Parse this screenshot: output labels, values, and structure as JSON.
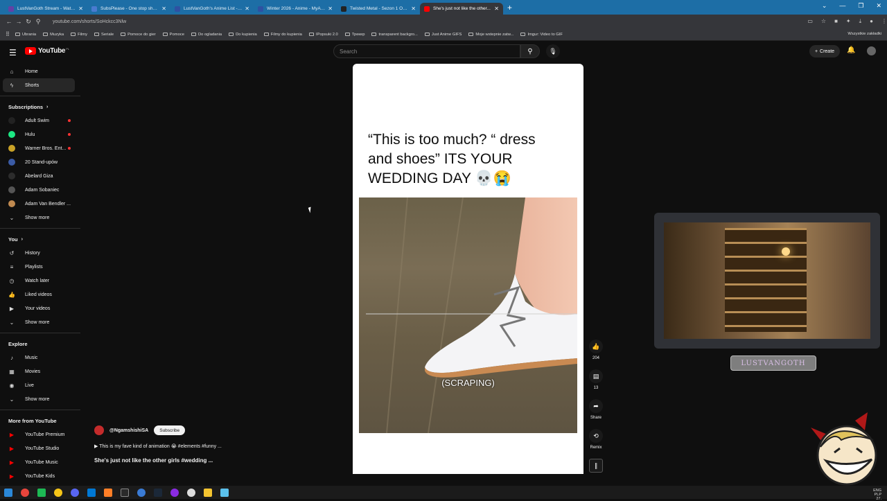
{
  "browser": {
    "tabs": [
      {
        "label": "LustVanGoth Stream - Watch Li...",
        "color": "#6441a5"
      },
      {
        "label": "SubsPlease - One stop shop fo...",
        "color": "#4a7bd0"
      },
      {
        "label": "LustVanGoth's Anime List - My...",
        "color": "#2e51a2"
      },
      {
        "label": "Winter 2026 - Anime - MyAnim...",
        "color": "#2e51a2"
      },
      {
        "label": "Twisted Metal - Sezon 1 Odcin...",
        "color": "#222222"
      },
      {
        "label": "She's just not like the other...",
        "color": "#ff0000",
        "active": true
      }
    ],
    "url": "youtube.com/shorts/SoHckcc3Nlw",
    "bookmarks": [
      "Ubrania",
      "Muzyka",
      "Filmy",
      "Seriale",
      "Pomoce do gier",
      "Pomoce",
      "Do ogladania",
      "Do kupienia",
      "Filmy do kupienia",
      "IPopsuki 2.0",
      "Трекер",
      "transparent backgro...",
      "Just Anime GIFS",
      "Moje wstepnie zatw...",
      "Imgur: Video to GIF"
    ],
    "bookmarks_right": "Wszystkie zakładki"
  },
  "yt": {
    "logo": "YouTube",
    "region": "PL",
    "search_placeholder": "Search",
    "create_label": "Create"
  },
  "sidebar": {
    "main": [
      {
        "label": "Home",
        "icon": "home-icon"
      },
      {
        "label": "Shorts",
        "icon": "shorts-icon",
        "active": true
      }
    ],
    "subscriptions_title": "Subscriptions",
    "subscriptions": [
      {
        "label": "Adult Swim",
        "color": "#222222",
        "live": true
      },
      {
        "label": "Hulu",
        "color": "#1ce783",
        "live": true
      },
      {
        "label": "Warner Bros. Ent...",
        "color": "#c9a227",
        "live": true
      },
      {
        "label": "20 Stand-upów",
        "color": "#3b5ba5",
        "live": false
      },
      {
        "label": "Abelard Giza",
        "color": "#2c2c2c",
        "live": false
      },
      {
        "label": "Adam Sobaniec",
        "color": "#555555",
        "live": false
      },
      {
        "label": "Adam Van Bendler ...",
        "color": "#c08a50",
        "live": false
      }
    ],
    "subs_show_more": "Show more",
    "you_title": "You",
    "you_items": [
      {
        "label": "History",
        "icon": "history-icon"
      },
      {
        "label": "Playlists",
        "icon": "playlists-icon"
      },
      {
        "label": "Watch later",
        "icon": "clock-icon"
      },
      {
        "label": "Liked videos",
        "icon": "thumbs-up-icon"
      },
      {
        "label": "Your videos",
        "icon": "video-icon"
      }
    ],
    "you_show_more": "Show more",
    "explore_title": "Explore",
    "explore_items": [
      {
        "label": "Music",
        "icon": "music-icon"
      },
      {
        "label": "Movies",
        "icon": "movies-icon"
      },
      {
        "label": "Live",
        "icon": "live-icon"
      }
    ],
    "explore_show_more": "Show more",
    "more_title": "More from YouTube",
    "more_items": [
      {
        "label": "YouTube Premium"
      },
      {
        "label": "YouTube Studio"
      },
      {
        "label": "YouTube Music"
      },
      {
        "label": "YouTube Kids"
      }
    ]
  },
  "short": {
    "caption_line1": "“This is too much? “ dress",
    "caption_line2": "and shoes” ITS YOUR",
    "caption_line3": "WEDDING DAY 💀😭",
    "subtitle": "(SCRAPING)",
    "likes": "204",
    "comments": "13",
    "share_label": "Share",
    "remix_label": "Remix",
    "channel": "@NgamshishiSA",
    "subscribe_label": "Subscribe",
    "description": "▶ This is my fave kind of animation 😭 #elements #funny ...",
    "title": "She's just not like the other girls #wedding ..."
  },
  "overlay": {
    "name_plate": "LUSTVANGOTH"
  },
  "tray": {
    "lang": "ENG",
    "layout": "PLP",
    "time": "27."
  }
}
